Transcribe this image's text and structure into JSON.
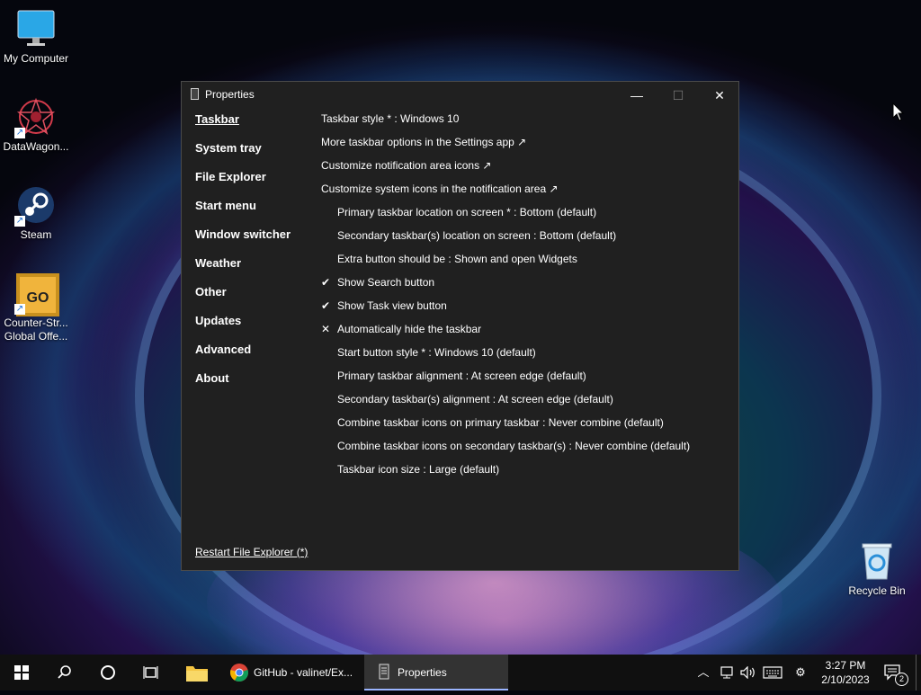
{
  "desktop": {
    "icons": [
      {
        "label": "My Computer"
      },
      {
        "label": "DataWagon..."
      },
      {
        "label": "Steam"
      },
      {
        "label": "Counter-Str...\nGlobal Offe..."
      },
      {
        "label": "Recycle Bin"
      }
    ]
  },
  "window": {
    "title": "Properties",
    "controls": {
      "minimize": "—",
      "maximize": "☐",
      "close": "✕"
    },
    "nav": [
      "Taskbar",
      "System tray",
      "File Explorer",
      "Start menu",
      "Window switcher",
      "Weather",
      "Other",
      "Updates",
      "Advanced",
      "About"
    ],
    "active_nav": "Taskbar",
    "restart_label": "Restart File Explorer (*)",
    "options": [
      {
        "text": "Taskbar style * : Windows 10",
        "mark": "",
        "indent": false
      },
      {
        "text": "More taskbar options in the Settings app ↗",
        "mark": "",
        "indent": false
      },
      {
        "text": "Customize notification area icons ↗",
        "mark": "",
        "indent": false
      },
      {
        "text": "Customize system icons in the notification area ↗",
        "mark": "",
        "indent": false
      },
      {
        "text": "Primary taskbar location on screen * : Bottom (default)",
        "mark": "",
        "indent": true
      },
      {
        "text": "Secondary taskbar(s) location on screen : Bottom (default)",
        "mark": "",
        "indent": true
      },
      {
        "text": "Extra button should be : Shown and open Widgets",
        "mark": "",
        "indent": true
      },
      {
        "text": "Show Search button",
        "mark": "✔",
        "indent": true
      },
      {
        "text": "Show Task view button",
        "mark": "✔",
        "indent": true
      },
      {
        "text": "Automatically hide the taskbar",
        "mark": "✕",
        "indent": true
      },
      {
        "text": "Start button style * : Windows 10 (default)",
        "mark": "",
        "indent": true
      },
      {
        "text": "Primary taskbar alignment : At screen edge (default)",
        "mark": "",
        "indent": true
      },
      {
        "text": "Secondary taskbar(s) alignment : At screen edge (default)",
        "mark": "",
        "indent": true
      },
      {
        "text": "Combine taskbar icons on primary taskbar : Never combine (default)",
        "mark": "",
        "indent": true
      },
      {
        "text": "Combine taskbar icons on secondary taskbar(s) : Never combine (default)",
        "mark": "",
        "indent": true
      },
      {
        "text": "Taskbar icon size : Large (default)",
        "mark": "",
        "indent": true
      }
    ]
  },
  "taskbar": {
    "tasks": [
      {
        "label": "GitHub - valinet/Ex..."
      },
      {
        "label": "Properties"
      }
    ],
    "clock": {
      "time": "3:27 PM",
      "date": "2/10/2023"
    },
    "notification_count": "2"
  },
  "colors": {
    "window_bg": "#202020",
    "taskbar_bg": "#101010",
    "accent": "#9bb5ff"
  }
}
